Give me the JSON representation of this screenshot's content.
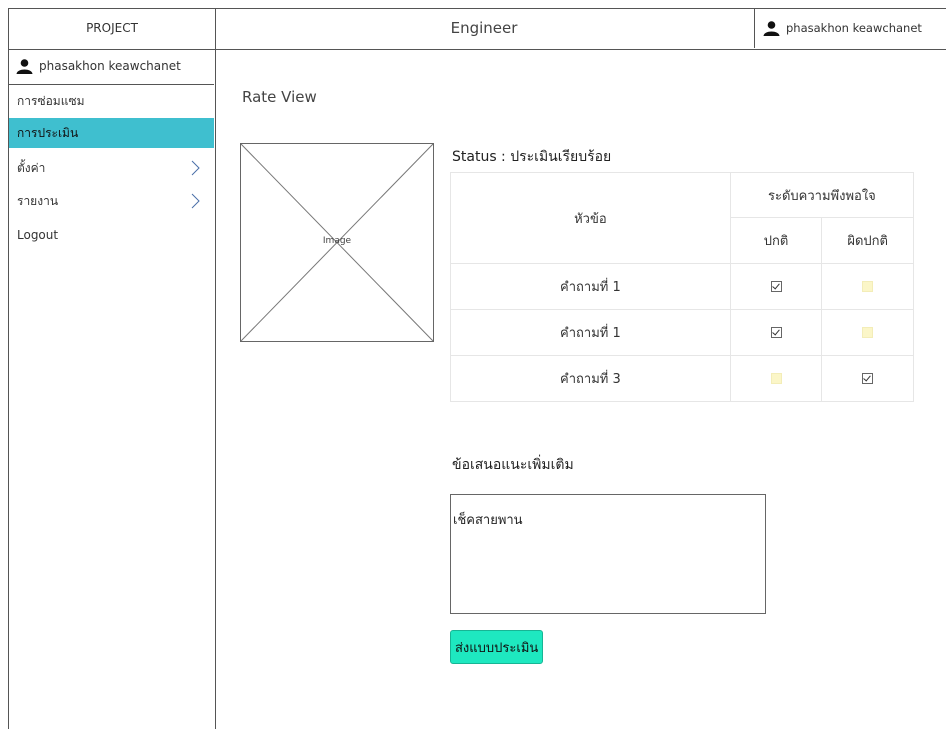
{
  "header": {
    "brand": "PROJECT",
    "page_title": "Engineer",
    "user_name": "phasakhon keawchanet"
  },
  "sidebar": {
    "user_name": "phasakhon keawchanet",
    "items": [
      {
        "label": "การซ่อมแซม",
        "active": false,
        "has_arrow": false
      },
      {
        "label": "การประเมิน",
        "active": true,
        "has_arrow": false
      },
      {
        "label": "ตั้งค่า",
        "active": false,
        "has_arrow": true
      },
      {
        "label": "รายงาน",
        "active": false,
        "has_arrow": true
      },
      {
        "label": "Logout",
        "active": false,
        "has_arrow": false
      }
    ]
  },
  "main": {
    "title": "Rate View",
    "image_label": "Image",
    "status": "Status : ประเมินเรียบร้อย",
    "table": {
      "topic_header": "หัวข้อ",
      "level_header": "ระดับความพึงพอใจ",
      "normal_header": "ปกติ",
      "abnormal_header": "ผิดปกติ",
      "rows": [
        {
          "question": "คำถามที่ 1",
          "normal": true,
          "abnormal": false
        },
        {
          "question": "คำถามที่ 1",
          "normal": true,
          "abnormal": false
        },
        {
          "question": "คำถามที่ 3",
          "normal": false,
          "abnormal": true
        }
      ]
    },
    "suggestion_title": "ข้อเสนอแนะเพิ่มเติม",
    "suggestion_value": "เช็คสายพาน",
    "submit_label": "ส่งแบบประเมิน"
  },
  "colors": {
    "active_menu": "#3fbfcf",
    "submit_button": "#1ee8c0",
    "unchecked_box": "#fbf6c8"
  }
}
